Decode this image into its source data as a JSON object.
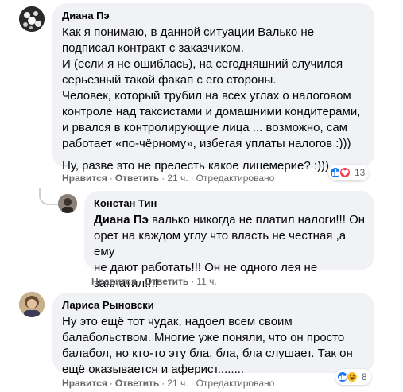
{
  "comments": [
    {
      "author": "Диана Пэ",
      "lines": [
        "Как я понимаю, в данной ситуации Валько не",
        "подписал контракт с заказчиком.",
        "И (если я не ошиблась), на сегодняшний случился",
        "серьезный такой факап с его стороны.",
        "Человек, который трубил на всех углах о налоговом",
        "контроле над таксистами и домашними кондитерами,",
        "и рвался в контролирующие лица ... возможно, сам",
        "работает «по-чёрному», избегая уплаты налогов :)))"
      ],
      "last_line": "Ну, разве это не прелесть какое лицемерие? :)))",
      "like": "Нравится",
      "reply": "Ответить",
      "time": "21 ч.",
      "edited": "Отредактировано",
      "reaction_count": "13"
    },
    {
      "author": "Констан Тин",
      "mention": "Диана Пэ",
      "lines_first": " валько никогда не платил налоги!!! Он",
      "lines": [
        "орет на каждом углу что власть не честная ,а ему",
        "не дают работать!!! Он не одного лея не",
        "заплатил!!!!"
      ],
      "like": "Нравится",
      "reply": "Ответить",
      "time": "11 ч."
    },
    {
      "author": "Лариса Рыновски",
      "lines": [
        "Ну это ещё тот чудак, надоел всем своим",
        "балабольством. Многие уже поняли, что он просто",
        "балабол, но кто-то эту бла, бла, бла слушает. Так он",
        "ещё оказывается и аферист........"
      ],
      "like": "Нравится",
      "reply": "Ответить",
      "time": "21 ч.",
      "edited": "Отредактировано",
      "reaction_count": "8"
    }
  ],
  "colors": {
    "bubble": "#f0f2f5",
    "like_blue": "#1877f2",
    "love_red": "#f33e58",
    "meta_gray": "#65676b"
  },
  "icons": [
    "like-icon",
    "love-icon",
    "haha-icon"
  ]
}
